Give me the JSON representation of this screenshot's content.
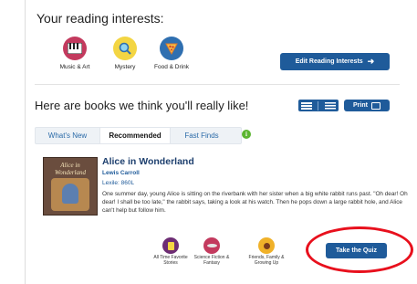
{
  "interests": {
    "heading": "Your reading interests:",
    "items": [
      {
        "label": "Music & Art",
        "icon": "piano-icon",
        "color": "#c33a5e"
      },
      {
        "label": "Mystery",
        "icon": "magnifying-glass-icon",
        "color": "#f3d543"
      },
      {
        "label": "Food & Drink",
        "icon": "pizza-icon",
        "color": "#2f6fb0"
      }
    ],
    "edit_button": "Edit Reading Interests"
  },
  "recommendations": {
    "heading": "Here are books we think you'll really like!",
    "print_label": "Print",
    "tabs": [
      {
        "label": "What's New",
        "active": false
      },
      {
        "label": "Recommended",
        "active": true
      },
      {
        "label": "Fast Finds",
        "active": false
      }
    ],
    "info_icon": "info-icon"
  },
  "book": {
    "cover_title": "Alice in Wonderland",
    "title": "Alice in Wonderland",
    "author": "Lewis Carroll",
    "lexile": "Lexile: 860L",
    "description": "One summer day, young Alice is sitting on the riverbank with her sister when a big white rabbit runs past. \"Oh dear! Oh dear! I shall be too late,\" the rabbit says, taking a look at his watch. Then he pops down a large rabbit hole, and Alice can't help but follow him."
  },
  "categories": [
    {
      "label": "All Time Favorite Stories",
      "icon": "book-icon",
      "color": "#6d2d74"
    },
    {
      "label": "Science Fiction & Fantasy",
      "icon": "ufo-icon",
      "color": "#c33a5e"
    },
    {
      "label": "Friends, Family & Growing Up",
      "icon": "person-icon",
      "color": "#f0b129"
    }
  ],
  "quiz_button": "Take the Quiz",
  "colors": {
    "accent": "#1f5b9a",
    "highlight": "#e8101d"
  }
}
